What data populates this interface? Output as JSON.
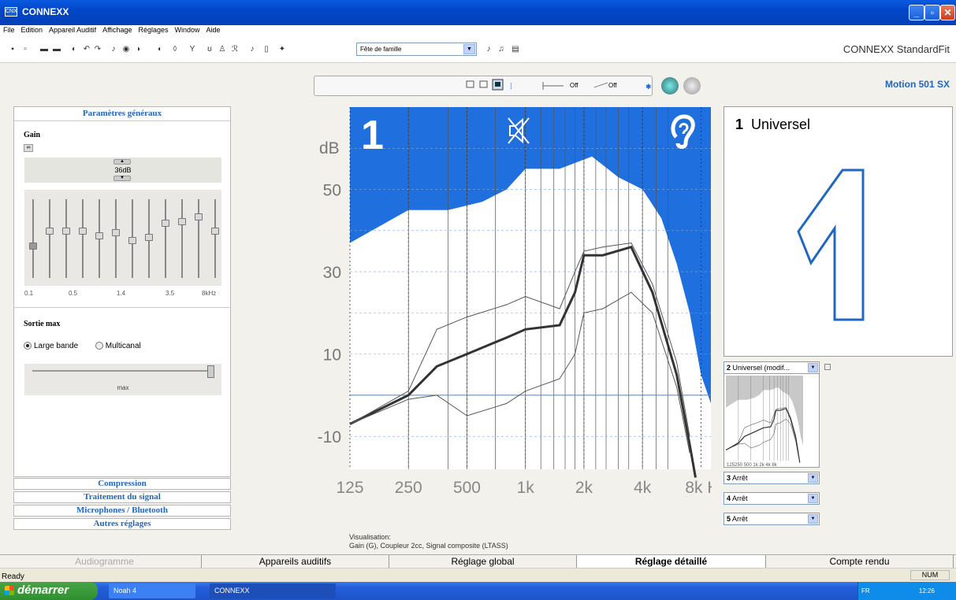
{
  "window": {
    "title": "CONNEXX",
    "minimize": "_",
    "maximize": "▫",
    "close": "✕",
    "app_icon_label": "CNX"
  },
  "menu": [
    "File",
    "Edition",
    "Appareil Auditif",
    "Affichage",
    "Réglages",
    "Window",
    "Aide"
  ],
  "toolbar": {
    "program_select": "Fête de famille",
    "brand": "CONNEXX StandardFit"
  },
  "vis_toolbar": {
    "off1": "Off",
    "off2": "Off"
  },
  "device_model": "Motion 501 SX",
  "left_panel": {
    "header": "Paramètres généraux",
    "gain_label": "Gain",
    "gain_value": "36dB",
    "freq_labels": [
      "0.1",
      "0.5",
      "1.4",
      "3.5",
      "8kHz"
    ],
    "sortie_label": "Sortie max",
    "radio_large": "Large bande",
    "radio_multi": "Multicanal",
    "max_label": "max",
    "sections": [
      "Compression",
      "Traitement du signal",
      "Microphones / Bluetooth",
      "Autres réglages"
    ]
  },
  "chart_data": {
    "type": "line",
    "y_unit_label": "dB",
    "x_tick_labels": [
      "125",
      "250",
      "500",
      "1k",
      "2k",
      "4k",
      "8k Hz"
    ],
    "x_ticks_hz": [
      125,
      250,
      500,
      1000,
      2000,
      4000,
      8000
    ],
    "y_ticks": [
      50,
      30,
      10,
      -10
    ],
    "ylim": [
      -18,
      70
    ],
    "xlim_hz": [
      125,
      9000
    ],
    "program_number": "1",
    "series": [
      {
        "values_hz": [
          [
            125,
            -7
          ],
          [
            250,
            0
          ],
          [
            350,
            7
          ],
          [
            500,
            10
          ],
          [
            800,
            14
          ],
          [
            1000,
            16
          ],
          [
            1500,
            17
          ],
          [
            1800,
            25
          ],
          [
            2000,
            34
          ],
          [
            2500,
            34
          ],
          [
            3500,
            36
          ],
          [
            4500,
            25
          ],
          [
            6000,
            5
          ],
          [
            7000,
            -12
          ],
          [
            7500,
            -20
          ]
        ]
      },
      {
        "values_hz": [
          [
            125,
            -7
          ],
          [
            250,
            1
          ],
          [
            350,
            16
          ],
          [
            500,
            19
          ],
          [
            800,
            22
          ],
          [
            1000,
            24
          ],
          [
            1500,
            21
          ],
          [
            1800,
            30
          ],
          [
            2000,
            35
          ],
          [
            2500,
            36
          ],
          [
            3500,
            37
          ],
          [
            4500,
            27
          ],
          [
            6000,
            8
          ],
          [
            7000,
            -10
          ]
        ]
      },
      {
        "values_hz": [
          [
            125,
            -7
          ],
          [
            250,
            -1
          ],
          [
            350,
            0
          ],
          [
            500,
            -5
          ],
          [
            800,
            -2
          ],
          [
            1000,
            1
          ],
          [
            1500,
            4
          ],
          [
            1800,
            10
          ],
          [
            2000,
            20
          ],
          [
            2500,
            21
          ],
          [
            3500,
            25
          ],
          [
            4500,
            20
          ],
          [
            6000,
            2
          ],
          [
            7000,
            -14
          ]
        ]
      }
    ],
    "uncomfortable_level": [
      [
        125,
        37
      ],
      [
        250,
        45
      ],
      [
        400,
        45
      ],
      [
        600,
        47
      ],
      [
        800,
        50
      ],
      [
        1000,
        55
      ],
      [
        1500,
        55
      ],
      [
        2200,
        58
      ],
      [
        3000,
        53
      ],
      [
        4000,
        50
      ],
      [
        5000,
        43
      ],
      [
        6000,
        32
      ],
      [
        7000,
        20
      ],
      [
        8000,
        5
      ],
      [
        9000,
        -2
      ]
    ]
  },
  "right_panel": {
    "prog_number": "1",
    "prog_name": "Universel",
    "big_number": "1",
    "program_slots": [
      {
        "num": "2",
        "label": "Universel (modif..."
      },
      {
        "num": "3",
        "label": "Arrêt"
      },
      {
        "num": "4",
        "label": "Arrêt"
      },
      {
        "num": "5",
        "label": "Arrêt"
      }
    ],
    "mini_x_labels": "125250 500  1k   2k  4k  8k"
  },
  "visualisation": {
    "title": "Visualisation:",
    "text": "Gain (G), Coupleur 2cc, Signal composite (LTASS)"
  },
  "tabs": [
    "Audiogramme",
    "Appareils auditifs",
    "Réglage global",
    "Réglage détaillé",
    "Compte rendu"
  ],
  "status": {
    "ready": "Ready",
    "num": "NUM"
  },
  "taskbar": {
    "start": "démarrer",
    "items": [
      "Noah 4",
      "CONNEXX"
    ],
    "time": "12:26",
    "lang": "FR"
  }
}
